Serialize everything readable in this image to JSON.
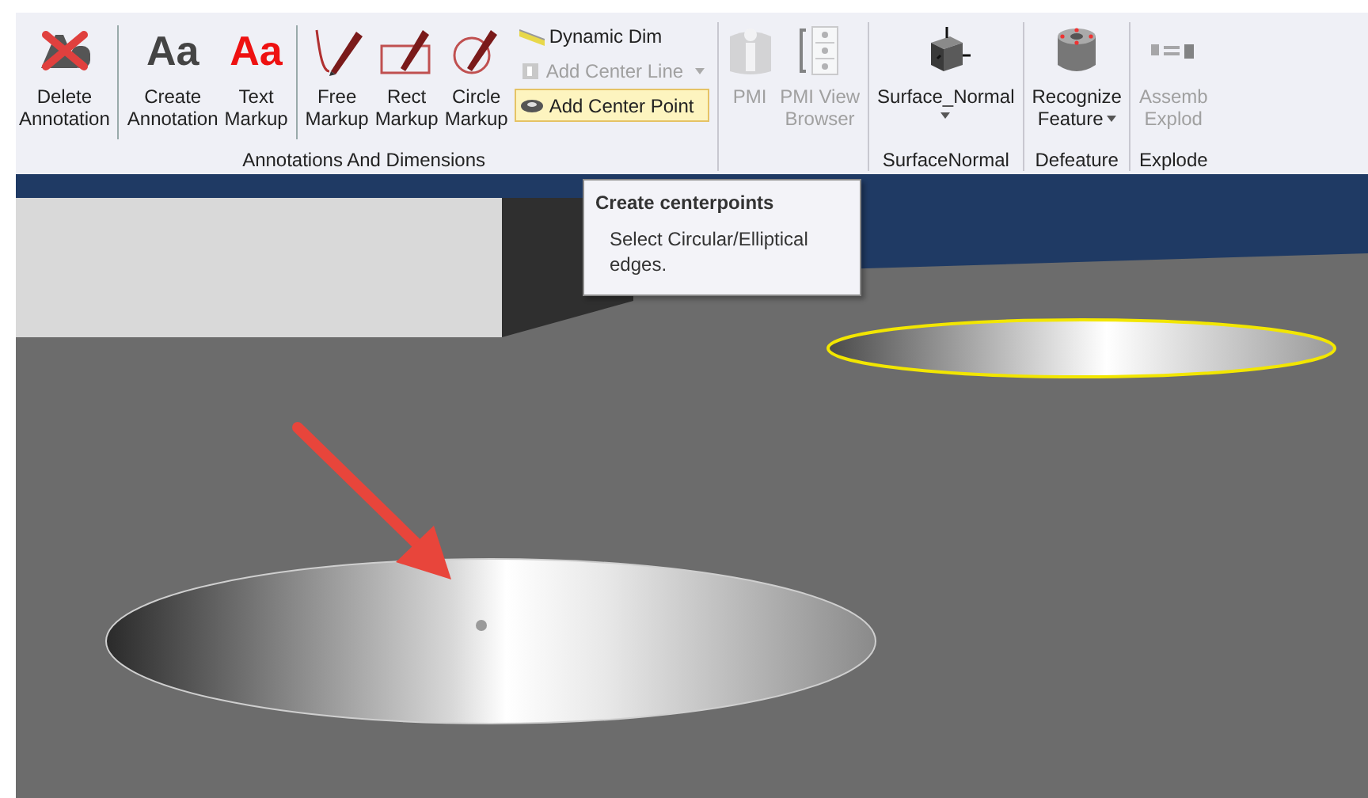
{
  "ribbon": {
    "groups": [
      {
        "label": "Annotations And Dimensions",
        "items": [
          {
            "kind": "large",
            "lines": [
              "Delete",
              "Annotation"
            ],
            "disabled": false
          },
          {
            "kind": "separator"
          },
          {
            "kind": "large",
            "lines": [
              "Create",
              "Annotation"
            ],
            "icon_text": "Aa",
            "disabled": false
          },
          {
            "kind": "large",
            "lines": [
              "Text",
              "Markup"
            ],
            "icon_text": "Aa",
            "disabled": false
          },
          {
            "kind": "separator"
          },
          {
            "kind": "large",
            "lines": [
              "Free",
              "Markup"
            ],
            "disabled": false
          },
          {
            "kind": "large",
            "lines": [
              "Rect",
              "Markup"
            ],
            "disabled": false
          },
          {
            "kind": "large",
            "lines": [
              "Circle",
              "Markup"
            ],
            "disabled": false
          },
          {
            "kind": "stack",
            "buttons": [
              {
                "label": "Dynamic Dim",
                "disabled": false,
                "highlighted": false,
                "dropdown": false
              },
              {
                "label": "Add Center Line",
                "disabled": true,
                "highlighted": false,
                "dropdown": true
              },
              {
                "label": "Add Center Point",
                "disabled": false,
                "highlighted": true,
                "dropdown": false
              }
            ]
          }
        ]
      },
      {
        "items": [
          {
            "kind": "large",
            "lines": [
              "PMI"
            ],
            "disabled": true
          },
          {
            "kind": "large",
            "lines": [
              "PMI View",
              "Browser"
            ],
            "disabled": true
          }
        ]
      },
      {
        "label": "SurfaceNormal",
        "items": [
          {
            "kind": "large",
            "lines": [
              "Surface_Normal"
            ],
            "dropdown": true,
            "disabled": false
          }
        ]
      },
      {
        "label": "Defeature",
        "items": [
          {
            "kind": "large",
            "lines": [
              "Recognize",
              "Feature"
            ],
            "dropdown": true,
            "disabled": false
          }
        ]
      },
      {
        "label": "Explode",
        "items": [
          {
            "kind": "large",
            "lines": [
              "Assemb",
              "Explod"
            ],
            "disabled": true
          }
        ]
      }
    ]
  },
  "tooltip": {
    "title": "Create centerpoints",
    "text": "Select Circular/Elliptical edges."
  }
}
